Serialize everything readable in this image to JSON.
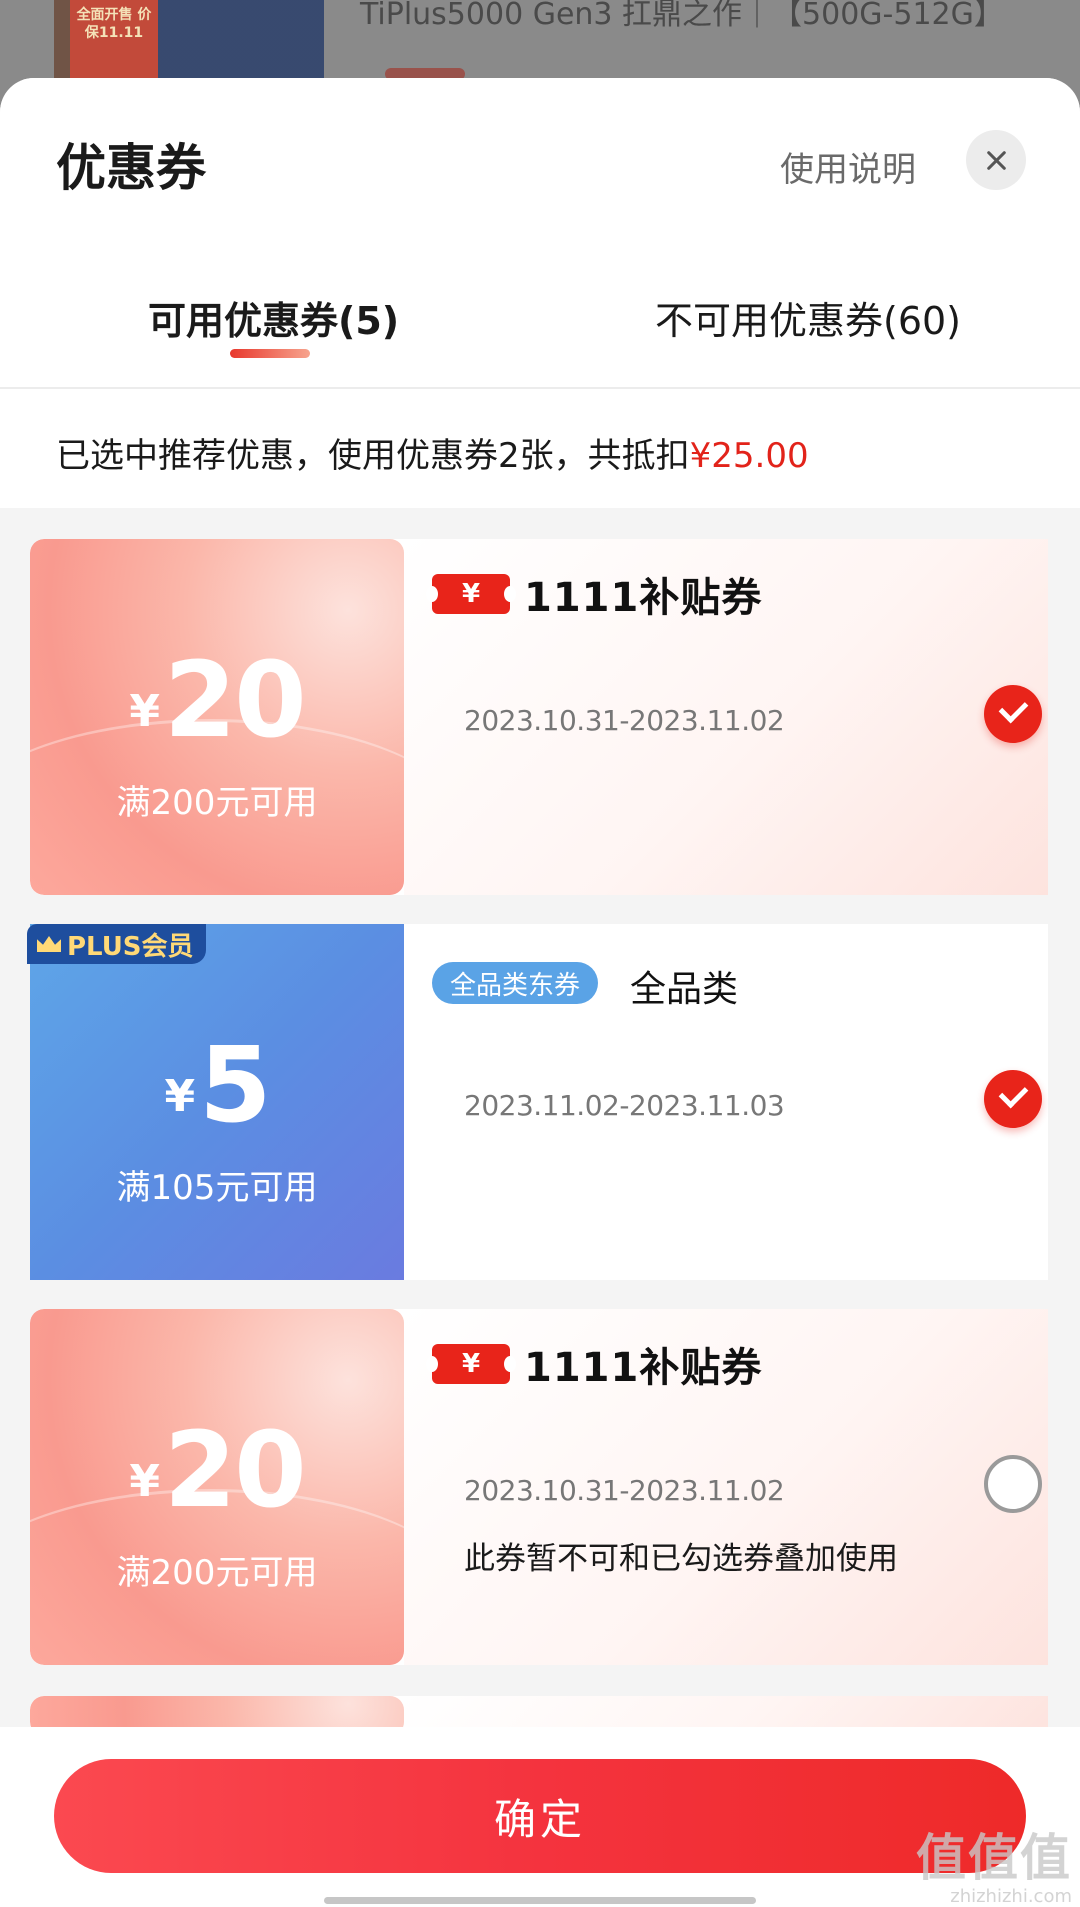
{
  "background": {
    "badge_text": "全面开售\n价保11.11",
    "product_title": "TiPlus5000 Gen3 扛鼎之作｜【500G-512G】"
  },
  "sheet": {
    "title": "优惠券",
    "help_label": "使用说明"
  },
  "tabs": [
    {
      "label": "可用优惠券(5)",
      "active": true
    },
    {
      "label": "不可用优惠券(60)",
      "active": false
    }
  ],
  "summary": {
    "text": "已选中推荐优惠，使用优惠券2张，共抵扣",
    "amount": "¥25.00"
  },
  "coupons": [
    {
      "currency": "¥",
      "value": "20",
      "condition": "满200元可用",
      "brand_icon": "¥",
      "brand_title": "1111补贴券",
      "date": "2023.10.31-2023.11.02",
      "selected": true,
      "note": ""
    },
    {
      "badge": "PLUS会员",
      "currency": "¥",
      "value": "5",
      "condition": "满105元可用",
      "tag": "全品类东券",
      "category": "全品类",
      "date": "2023.11.02-2023.11.03",
      "selected": true
    },
    {
      "currency": "¥",
      "value": "20",
      "condition": "满200元可用",
      "brand_icon": "¥",
      "brand_title": "1111补贴券",
      "date": "2023.10.31-2023.11.02",
      "selected": false,
      "note": "此券暂不可和已勾选券叠加使用"
    }
  ],
  "footer": {
    "confirm_label": "确定"
  },
  "watermark": {
    "big": "值值值",
    "small": "zhizhizhi.com"
  },
  "colors": {
    "accent_red": "#e2231a",
    "plus_blue": "#5b8ee2"
  }
}
